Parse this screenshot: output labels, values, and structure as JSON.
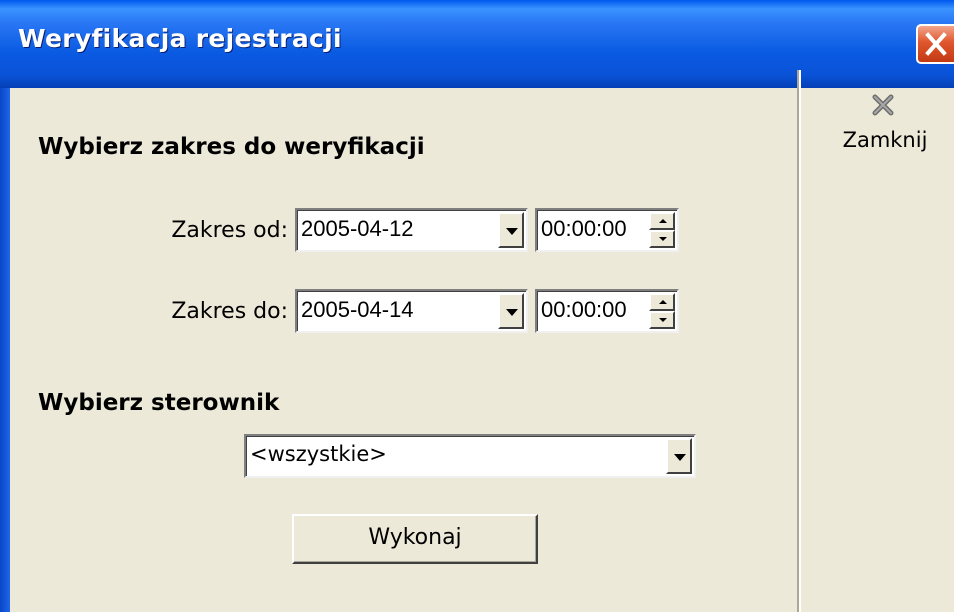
{
  "window": {
    "title": "Weryfikacja rejestracji"
  },
  "toolbar": {
    "close_label": "Zamknij",
    "close_icon": "close-x-icon"
  },
  "range_section": {
    "heading": "Wybierz zakres do weryfikacji",
    "from": {
      "label": "Zakres od:",
      "date": "2005-04-12",
      "time": "00:00:00"
    },
    "to": {
      "label": "Zakres do:",
      "date": "2005-04-14",
      "time": "00:00:00"
    }
  },
  "controller_section": {
    "heading": "Wybierz sterownik",
    "selected": "<wszystkie>"
  },
  "actions": {
    "execute_label": "Wykonaj"
  },
  "colors": {
    "title_bar": "#0a5ae2",
    "window_bg": "#ece9d8",
    "close_button": "#e0562d"
  }
}
